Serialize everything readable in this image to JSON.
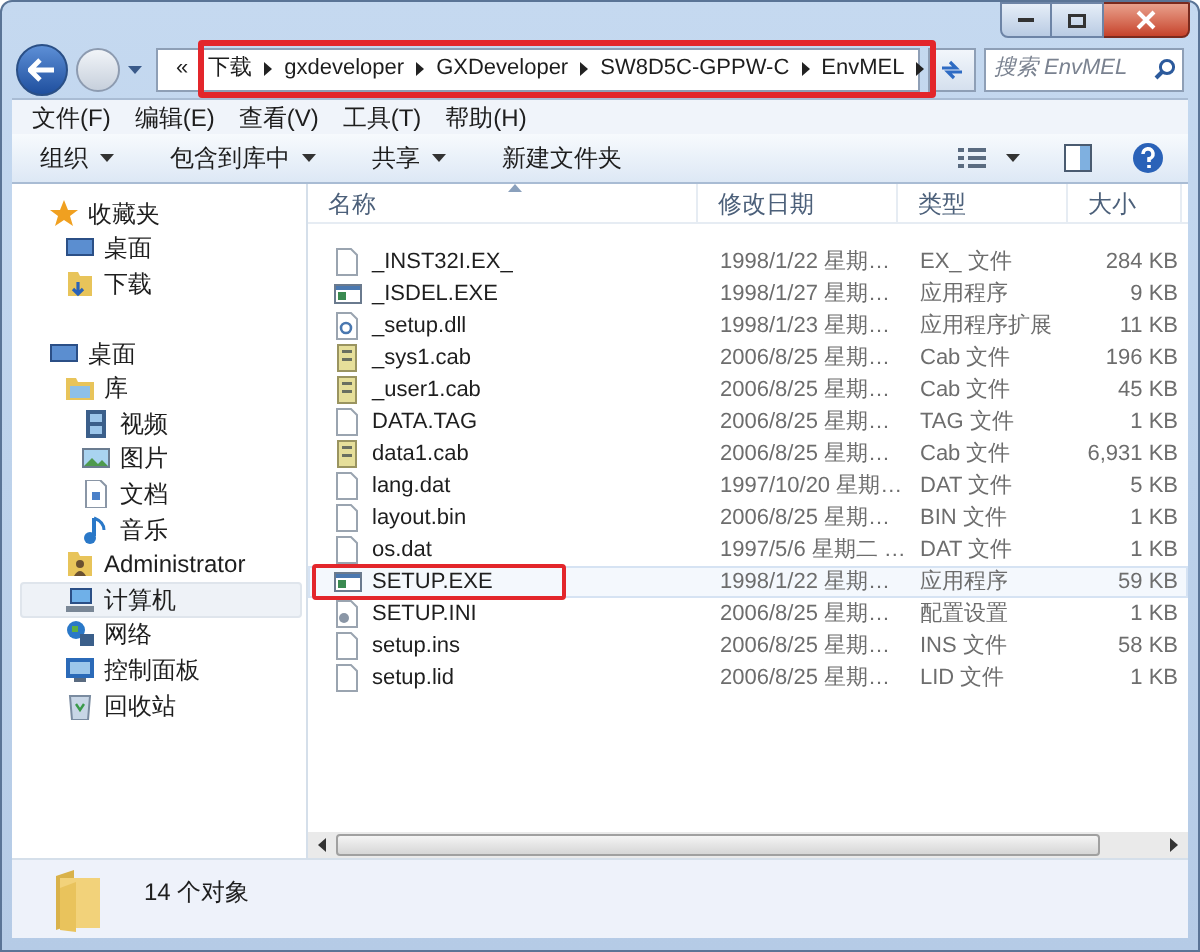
{
  "address_bar": {
    "overflow": "«",
    "segments": [
      "下载",
      "gxdeveloper",
      "GXDeveloper",
      "SW8D5C-GPPW-C",
      "EnvMEL"
    ],
    "highlighted": true
  },
  "search": {
    "placeholder": "搜索 EnvMEL"
  },
  "menu": [
    "文件(F)",
    "编辑(E)",
    "查看(V)",
    "工具(T)",
    "帮助(H)"
  ],
  "toolbar": [
    {
      "label": "组织",
      "dropdown": true
    },
    {
      "label": "包含到库中",
      "dropdown": true
    },
    {
      "label": "共享",
      "dropdown": true
    },
    {
      "label": "新建文件夹",
      "dropdown": false
    }
  ],
  "sidebar": {
    "sections": [
      {
        "label": "收藏夹",
        "kind": "star",
        "selected": false,
        "children": [
          {
            "label": "桌面",
            "kind": "desktop",
            "selected": false
          },
          {
            "label": "下载",
            "kind": "download",
            "selected": false
          }
        ]
      },
      {
        "label": "桌面",
        "kind": "desktop",
        "selected": false,
        "children": [
          {
            "label": "库",
            "kind": "library",
            "selected": false,
            "children": [
              {
                "label": "视频",
                "kind": "video",
                "selected": false
              },
              {
                "label": "图片",
                "kind": "picture",
                "selected": false
              },
              {
                "label": "文档",
                "kind": "document",
                "selected": false
              },
              {
                "label": "音乐",
                "kind": "music",
                "selected": false
              }
            ]
          },
          {
            "label": "Administrator",
            "kind": "user",
            "selected": false
          },
          {
            "label": "计算机",
            "kind": "computer",
            "selected": true
          },
          {
            "label": "网络",
            "kind": "network",
            "selected": false
          },
          {
            "label": "控制面板",
            "kind": "control",
            "selected": false
          },
          {
            "label": "回收站",
            "kind": "recycle",
            "selected": false
          }
        ]
      }
    ]
  },
  "table": {
    "columns": [
      "名称",
      "修改日期",
      "类型",
      "大小"
    ],
    "rows": [
      {
        "name": "_INST32I.EX_",
        "date": "1998/1/22 星期…",
        "type": "EX_ 文件",
        "size": "284 KB",
        "kind": "blank",
        "selected": false,
        "highlighted": false
      },
      {
        "name": "_ISDEL.EXE",
        "date": "1998/1/27 星期…",
        "type": "应用程序",
        "size": "9 KB",
        "kind": "exe",
        "selected": false,
        "highlighted": false
      },
      {
        "name": "_setup.dll",
        "date": "1998/1/23 星期…",
        "type": "应用程序扩展",
        "size": "11 KB",
        "kind": "dll",
        "selected": false,
        "highlighted": false
      },
      {
        "name": "_sys1.cab",
        "date": "2006/8/25 星期…",
        "type": "Cab 文件",
        "size": "196 KB",
        "kind": "cab",
        "selected": false,
        "highlighted": false
      },
      {
        "name": "_user1.cab",
        "date": "2006/8/25 星期…",
        "type": "Cab 文件",
        "size": "45 KB",
        "kind": "cab",
        "selected": false,
        "highlighted": false
      },
      {
        "name": "DATA.TAG",
        "date": "2006/8/25 星期…",
        "type": "TAG 文件",
        "size": "1 KB",
        "kind": "blank",
        "selected": false,
        "highlighted": false
      },
      {
        "name": "data1.cab",
        "date": "2006/8/25 星期…",
        "type": "Cab 文件",
        "size": "6,931 KB",
        "kind": "cab",
        "selected": false,
        "highlighted": false
      },
      {
        "name": "lang.dat",
        "date": "1997/10/20 星期…",
        "type": "DAT 文件",
        "size": "5 KB",
        "kind": "blank",
        "selected": false,
        "highlighted": false
      },
      {
        "name": "layout.bin",
        "date": "2006/8/25 星期…",
        "type": "BIN 文件",
        "size": "1 KB",
        "kind": "blank",
        "selected": false,
        "highlighted": false
      },
      {
        "name": "os.dat",
        "date": "1997/5/6 星期二 …",
        "type": "DAT 文件",
        "size": "1 KB",
        "kind": "blank",
        "selected": false,
        "highlighted": false
      },
      {
        "name": "SETUP.EXE",
        "date": "1998/1/22 星期…",
        "type": "应用程序",
        "size": "59 KB",
        "kind": "exe",
        "selected": true,
        "highlighted": true
      },
      {
        "name": "SETUP.INI",
        "date": "2006/8/25 星期…",
        "type": "配置设置",
        "size": "1 KB",
        "kind": "ini",
        "selected": false,
        "highlighted": false
      },
      {
        "name": "setup.ins",
        "date": "2006/8/25 星期…",
        "type": "INS 文件",
        "size": "58 KB",
        "kind": "blank",
        "selected": false,
        "highlighted": false
      },
      {
        "name": "setup.lid",
        "date": "2006/8/25 星期…",
        "type": "LID 文件",
        "size": "1 KB",
        "kind": "blank",
        "selected": false,
        "highlighted": false
      }
    ]
  },
  "status_bar": {
    "text": "14 个对象"
  }
}
